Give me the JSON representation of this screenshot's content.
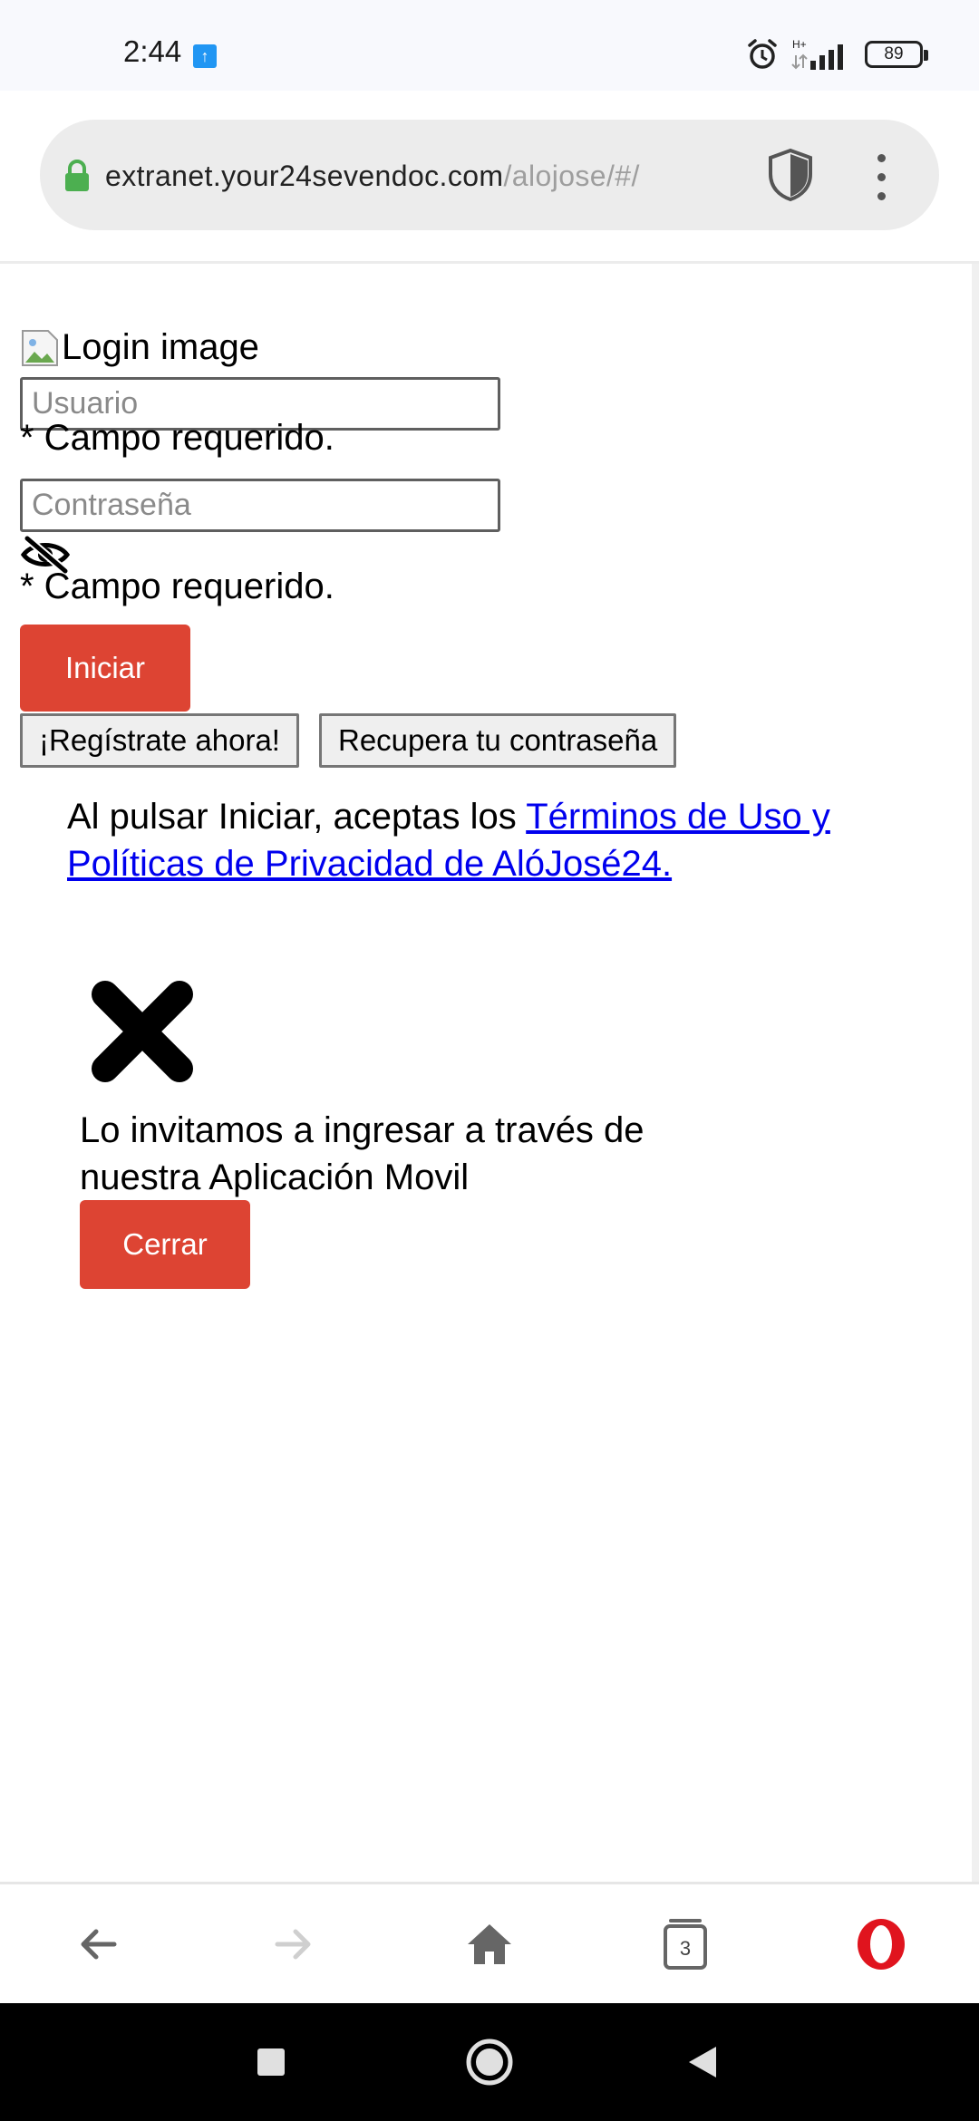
{
  "status_bar": {
    "time": "2:44",
    "network": "H+",
    "battery": "89",
    "icons": [
      "upload-notification-icon",
      "alarm-icon",
      "signal-icon",
      "battery-icon"
    ]
  },
  "browser": {
    "url_host": "extranet.your24sevendoc.com",
    "url_path": "/alojose/#/",
    "tab_count": "3"
  },
  "login": {
    "image_alt": "Login image",
    "username_placeholder": "Usuario",
    "username_required": "* Campo requerido.",
    "password_placeholder": "Contraseña",
    "password_required": "* Campo requerido.",
    "submit_label": "Iniciar",
    "register_label": "¡Regístrate ahora!",
    "recover_label": "Recupera tu contraseña",
    "terms_prefix": "Al pulsar Iniciar, aceptas los ",
    "terms_link": "Términos de Uso y Políticas de Privacidad de AlóJosé24."
  },
  "modal": {
    "message": "Lo invitamos a ingresar a través de nuestra Aplicación Movil",
    "close_label": "Cerrar"
  },
  "colors": {
    "accent_red": "#dd4433",
    "link_blue": "#0000ee",
    "lock_green": "#4caf50",
    "opera_red": "#e0141e"
  }
}
